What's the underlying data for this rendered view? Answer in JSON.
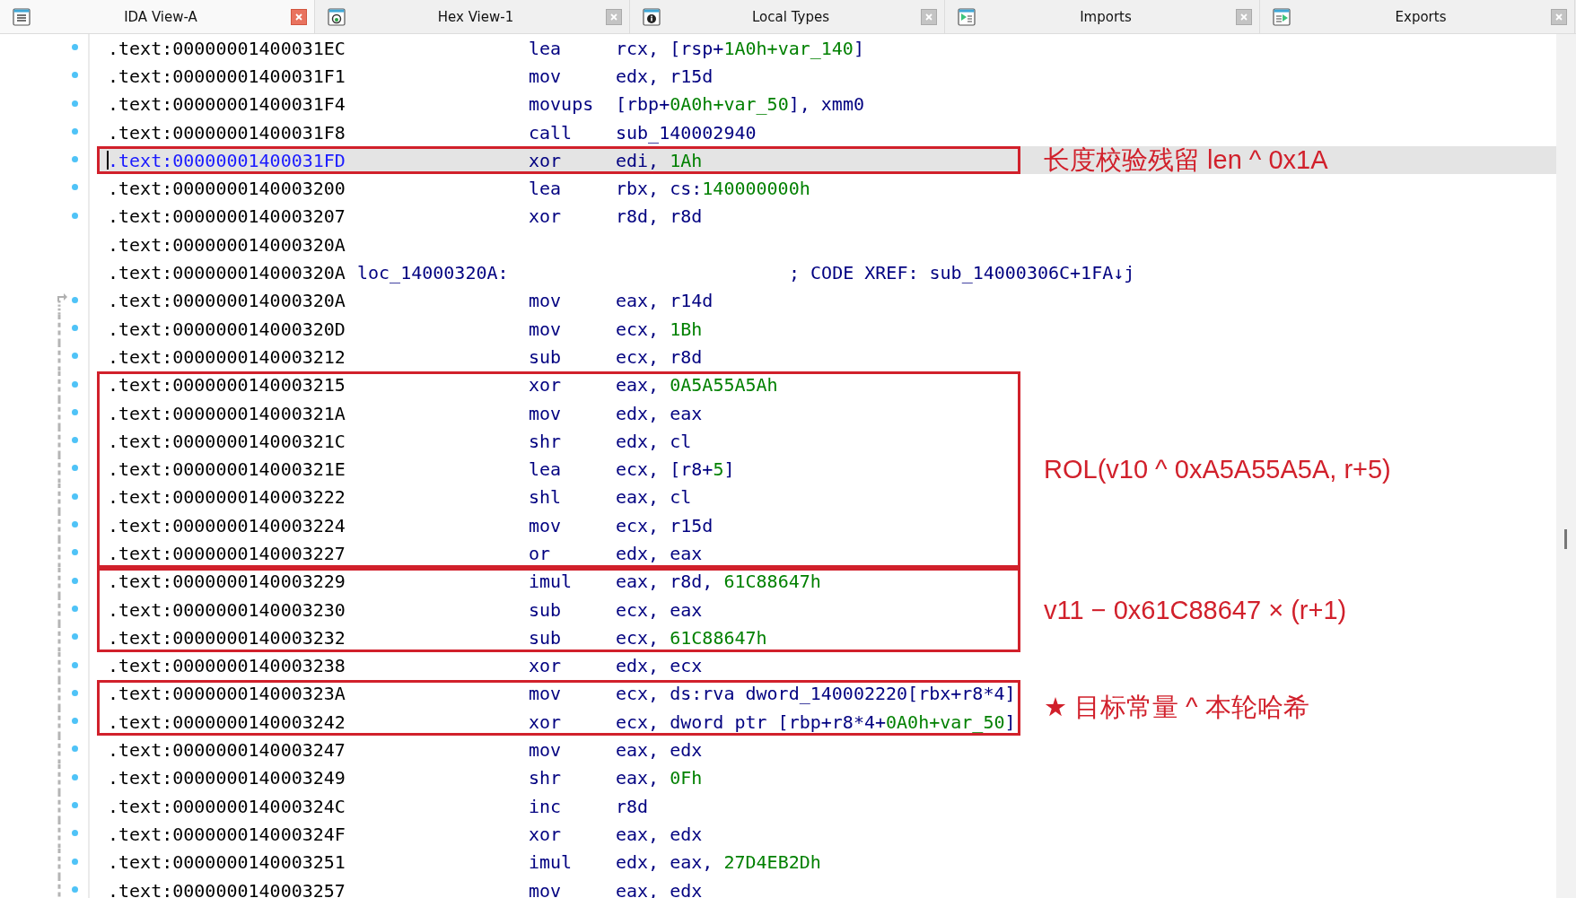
{
  "tabs": [
    {
      "label": "IDA View-A",
      "selected": true
    },
    {
      "label": "Hex View-1",
      "selected": false
    },
    {
      "label": "Local Types",
      "selected": false
    },
    {
      "label": "Imports",
      "selected": false
    },
    {
      "label": "Exports",
      "selected": false
    }
  ],
  "segments": [
    {
      "boxed": false,
      "lines": [
        {
          "kind": "insn",
          "address": ".text:00000001400031EC",
          "marker": true,
          "selected": false,
          "mnemonic": "lea",
          "operands": [
            {
              "text": "rcx, [rsp+",
              "kind": "reg"
            },
            {
              "text": "1A0h+var_140",
              "kind": "num"
            },
            {
              "text": "]",
              "kind": "reg"
            }
          ]
        },
        {
          "kind": "insn",
          "address": ".text:00000001400031F1",
          "marker": true,
          "selected": false,
          "mnemonic": "mov",
          "operands": [
            {
              "text": "edx, r15d",
              "kind": "reg"
            }
          ]
        },
        {
          "kind": "insn",
          "address": ".text:00000001400031F4",
          "marker": true,
          "selected": false,
          "mnemonic": "movups",
          "operands": [
            {
              "text": "[rbp+",
              "kind": "reg"
            },
            {
              "text": "0A0h+var_50",
              "kind": "num"
            },
            {
              "text": "], xmm0",
              "kind": "reg"
            }
          ]
        },
        {
          "kind": "insn",
          "address": ".text:00000001400031F8",
          "marker": true,
          "selected": false,
          "mnemonic": "call",
          "operands": [
            {
              "text": "sub_140002940",
              "kind": "reg"
            }
          ]
        }
      ]
    },
    {
      "boxed": true,
      "note": "长度校验残留 len ^ 0x1A",
      "lines": [
        {
          "kind": "insn",
          "address": ".text:00000001400031FD",
          "marker": true,
          "selected": true,
          "mnemonic": "xor",
          "operands": [
            {
              "text": "edi, ",
              "kind": "reg"
            },
            {
              "text": "1Ah",
              "kind": "num"
            }
          ]
        }
      ]
    },
    {
      "boxed": false,
      "lines": [
        {
          "kind": "insn",
          "address": ".text:0000000140003200",
          "marker": true,
          "selected": false,
          "mnemonic": "lea",
          "operands": [
            {
              "text": "rbx, cs:",
              "kind": "reg"
            },
            {
              "text": "140000000h",
              "kind": "num"
            }
          ]
        },
        {
          "kind": "insn",
          "address": ".text:0000000140003207",
          "marker": true,
          "selected": false,
          "mnemonic": "xor",
          "operands": [
            {
              "text": "r8d, r8d",
              "kind": "reg"
            }
          ]
        },
        {
          "kind": "blank",
          "address": ".text:000000014000320A",
          "marker": false,
          "selected": false
        },
        {
          "kind": "label",
          "address": ".text:000000014000320A",
          "marker": false,
          "selected": false,
          "label": "loc_14000320A:",
          "comment": "; CODE XREF: sub_14000306C+1FA↓j"
        },
        {
          "kind": "insn",
          "address": ".text:000000014000320A",
          "marker": true,
          "selected": false,
          "jump_target": true,
          "mnemonic": "mov",
          "operands": [
            {
              "text": "eax, r14d",
              "kind": "reg"
            }
          ]
        },
        {
          "kind": "insn",
          "address": ".text:000000014000320D",
          "marker": true,
          "selected": false,
          "mnemonic": "mov",
          "operands": [
            {
              "text": "ecx, ",
              "kind": "reg"
            },
            {
              "text": "1Bh",
              "kind": "num"
            }
          ]
        },
        {
          "kind": "insn",
          "address": ".text:0000000140003212",
          "marker": true,
          "selected": false,
          "mnemonic": "sub",
          "operands": [
            {
              "text": "ecx, r8d",
              "kind": "reg"
            }
          ]
        }
      ]
    },
    {
      "boxed": true,
      "note": "ROL(v10 ^ 0xA5A55A5A, r+5)",
      "lines": [
        {
          "kind": "insn",
          "address": ".text:0000000140003215",
          "marker": true,
          "selected": false,
          "mnemonic": "xor",
          "operands": [
            {
              "text": "eax, ",
              "kind": "reg"
            },
            {
              "text": "0A5A55A5Ah",
              "kind": "num"
            }
          ]
        },
        {
          "kind": "insn",
          "address": ".text:000000014000321A",
          "marker": true,
          "selected": false,
          "mnemonic": "mov",
          "operands": [
            {
              "text": "edx, eax",
              "kind": "reg"
            }
          ]
        },
        {
          "kind": "insn",
          "address": ".text:000000014000321C",
          "marker": true,
          "selected": false,
          "mnemonic": "shr",
          "operands": [
            {
              "text": "edx, cl",
              "kind": "reg"
            }
          ]
        },
        {
          "kind": "insn",
          "address": ".text:000000014000321E",
          "marker": true,
          "selected": false,
          "mnemonic": "lea",
          "operands": [
            {
              "text": "ecx, [r8+",
              "kind": "reg"
            },
            {
              "text": "5",
              "kind": "num"
            },
            {
              "text": "]",
              "kind": "reg"
            }
          ]
        },
        {
          "kind": "insn",
          "address": ".text:0000000140003222",
          "marker": true,
          "selected": false,
          "mnemonic": "shl",
          "operands": [
            {
              "text": "eax, cl",
              "kind": "reg"
            }
          ]
        },
        {
          "kind": "insn",
          "address": ".text:0000000140003224",
          "marker": true,
          "selected": false,
          "mnemonic": "mov",
          "operands": [
            {
              "text": "ecx, r15d",
              "kind": "reg"
            }
          ]
        },
        {
          "kind": "insn",
          "address": ".text:0000000140003227",
          "marker": true,
          "selected": false,
          "mnemonic": "or",
          "operands": [
            {
              "text": "edx, eax",
              "kind": "reg"
            }
          ]
        }
      ]
    },
    {
      "boxed": true,
      "note": "v11 − 0x61C88647 × (r+1)",
      "lines": [
        {
          "kind": "insn",
          "address": ".text:0000000140003229",
          "marker": true,
          "selected": false,
          "mnemonic": "imul",
          "operands": [
            {
              "text": "eax, r8d, ",
              "kind": "reg"
            },
            {
              "text": "61C88647h",
              "kind": "num"
            }
          ]
        },
        {
          "kind": "insn",
          "address": ".text:0000000140003230",
          "marker": true,
          "selected": false,
          "mnemonic": "sub",
          "operands": [
            {
              "text": "ecx, eax",
              "kind": "reg"
            }
          ]
        },
        {
          "kind": "insn",
          "address": ".text:0000000140003232",
          "marker": true,
          "selected": false,
          "mnemonic": "sub",
          "operands": [
            {
              "text": "ecx, ",
              "kind": "reg"
            },
            {
              "text": "61C88647h",
              "kind": "num"
            }
          ]
        }
      ]
    },
    {
      "boxed": false,
      "lines": [
        {
          "kind": "insn",
          "address": ".text:0000000140003238",
          "marker": true,
          "selected": false,
          "mnemonic": "xor",
          "operands": [
            {
              "text": "edx, ecx",
              "kind": "reg"
            }
          ]
        }
      ]
    },
    {
      "boxed": true,
      "note": "★ 目标常量 ^ 本轮哈希",
      "lines": [
        {
          "kind": "insn",
          "address": ".text:000000014000323A",
          "marker": true,
          "selected": false,
          "mnemonic": "mov",
          "operands": [
            {
              "text": "ecx, ds:rva dword_140002220[rbx+r8*4]",
              "kind": "reg"
            }
          ]
        },
        {
          "kind": "insn",
          "address": ".text:0000000140003242",
          "marker": true,
          "selected": false,
          "mnemonic": "xor",
          "operands": [
            {
              "text": "ecx, dword ptr [rbp+r8*4+",
              "kind": "reg"
            },
            {
              "text": "0A0h+var_50",
              "kind": "num"
            },
            {
              "text": "]",
              "kind": "reg"
            }
          ]
        }
      ]
    },
    {
      "boxed": false,
      "lines": [
        {
          "kind": "insn",
          "address": ".text:0000000140003247",
          "marker": true,
          "selected": false,
          "mnemonic": "mov",
          "operands": [
            {
              "text": "eax, edx",
              "kind": "reg"
            }
          ]
        },
        {
          "kind": "insn",
          "address": ".text:0000000140003249",
          "marker": true,
          "selected": false,
          "mnemonic": "shr",
          "operands": [
            {
              "text": "eax, ",
              "kind": "reg"
            },
            {
              "text": "0Fh",
              "kind": "num"
            }
          ]
        },
        {
          "kind": "insn",
          "address": ".text:000000014000324C",
          "marker": true,
          "selected": false,
          "mnemonic": "inc",
          "operands": [
            {
              "text": "r8d",
              "kind": "reg"
            }
          ]
        },
        {
          "kind": "insn",
          "address": ".text:000000014000324F",
          "marker": true,
          "selected": false,
          "mnemonic": "xor",
          "operands": [
            {
              "text": "eax, edx",
              "kind": "reg"
            }
          ]
        },
        {
          "kind": "insn",
          "address": ".text:0000000140003251",
          "marker": true,
          "selected": false,
          "mnemonic": "imul",
          "operands": [
            {
              "text": "edx, eax, ",
              "kind": "reg"
            },
            {
              "text": "27D4EB2Dh",
              "kind": "num"
            }
          ]
        },
        {
          "kind": "insn",
          "address": ".text:0000000140003257",
          "marker": true,
          "selected": false,
          "mnemonic": "mov",
          "operands": [
            {
              "text": "eax, edx",
              "kind": "reg"
            }
          ]
        }
      ]
    }
  ]
}
